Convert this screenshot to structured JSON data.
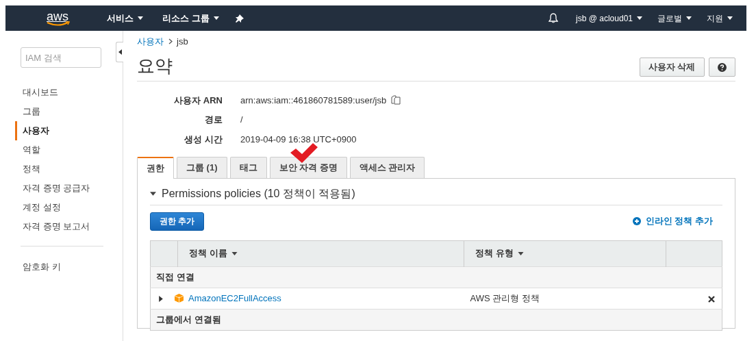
{
  "navbar": {
    "logo": "aws",
    "menus": [
      {
        "label": "서비스"
      },
      {
        "label": "리소스 그룹"
      }
    ],
    "account": "jsb @ acloud01",
    "region": "글로벌",
    "support": "지원"
  },
  "sidebar": {
    "search": {
      "placeholder": "IAM 검색"
    },
    "items": [
      {
        "label": "대시보드",
        "selected": false
      },
      {
        "label": "그룹",
        "selected": false
      },
      {
        "label": "사용자",
        "selected": true
      },
      {
        "label": "역할",
        "selected": false
      },
      {
        "label": "정책",
        "selected": false
      },
      {
        "label": "자격 증명 공급자",
        "selected": false
      },
      {
        "label": "계정 설정",
        "selected": false
      },
      {
        "label": "자격 증명 보고서",
        "selected": false
      }
    ],
    "extra_items": [
      {
        "label": "암호화 키",
        "selected": false
      }
    ]
  },
  "breadcrumb": [
    "사용자",
    "jsb"
  ],
  "title": "요약",
  "delete_button": "사용자 삭제",
  "details": [
    {
      "label": "사용자 ARN",
      "value": "arn:aws:iam::461860781589:user/jsb",
      "copyable": true
    },
    {
      "label": "경로",
      "value": "/",
      "copyable": false
    },
    {
      "label": "생성 시간",
      "value": "2019-04-09 16:38 UTC+0900",
      "copyable": false
    }
  ],
  "tabs": [
    {
      "label": "권한",
      "selected": true
    },
    {
      "label": "그룹 (1)",
      "selected": false
    },
    {
      "label": "태그",
      "selected": false
    },
    {
      "label": "보안 자격 증명",
      "selected": false
    },
    {
      "label": "액세스 관리자",
      "selected": false
    }
  ],
  "panel": {
    "heading": "Permissions policies (10 정책이 적용됨)",
    "expanded": true,
    "add_button": "권한 추가",
    "inline_link": "인라인 정책 추가",
    "columns": [
      "정책 이름",
      "정책 유형"
    ],
    "rows": [
      {
        "kind": "group",
        "label": "직접 연결"
      },
      {
        "kind": "policy",
        "name": "AmazonEC2FullAccess",
        "type": "AWS 관리형 정책"
      },
      {
        "kind": "group",
        "label": "그룹에서 연결됨"
      }
    ]
  }
}
